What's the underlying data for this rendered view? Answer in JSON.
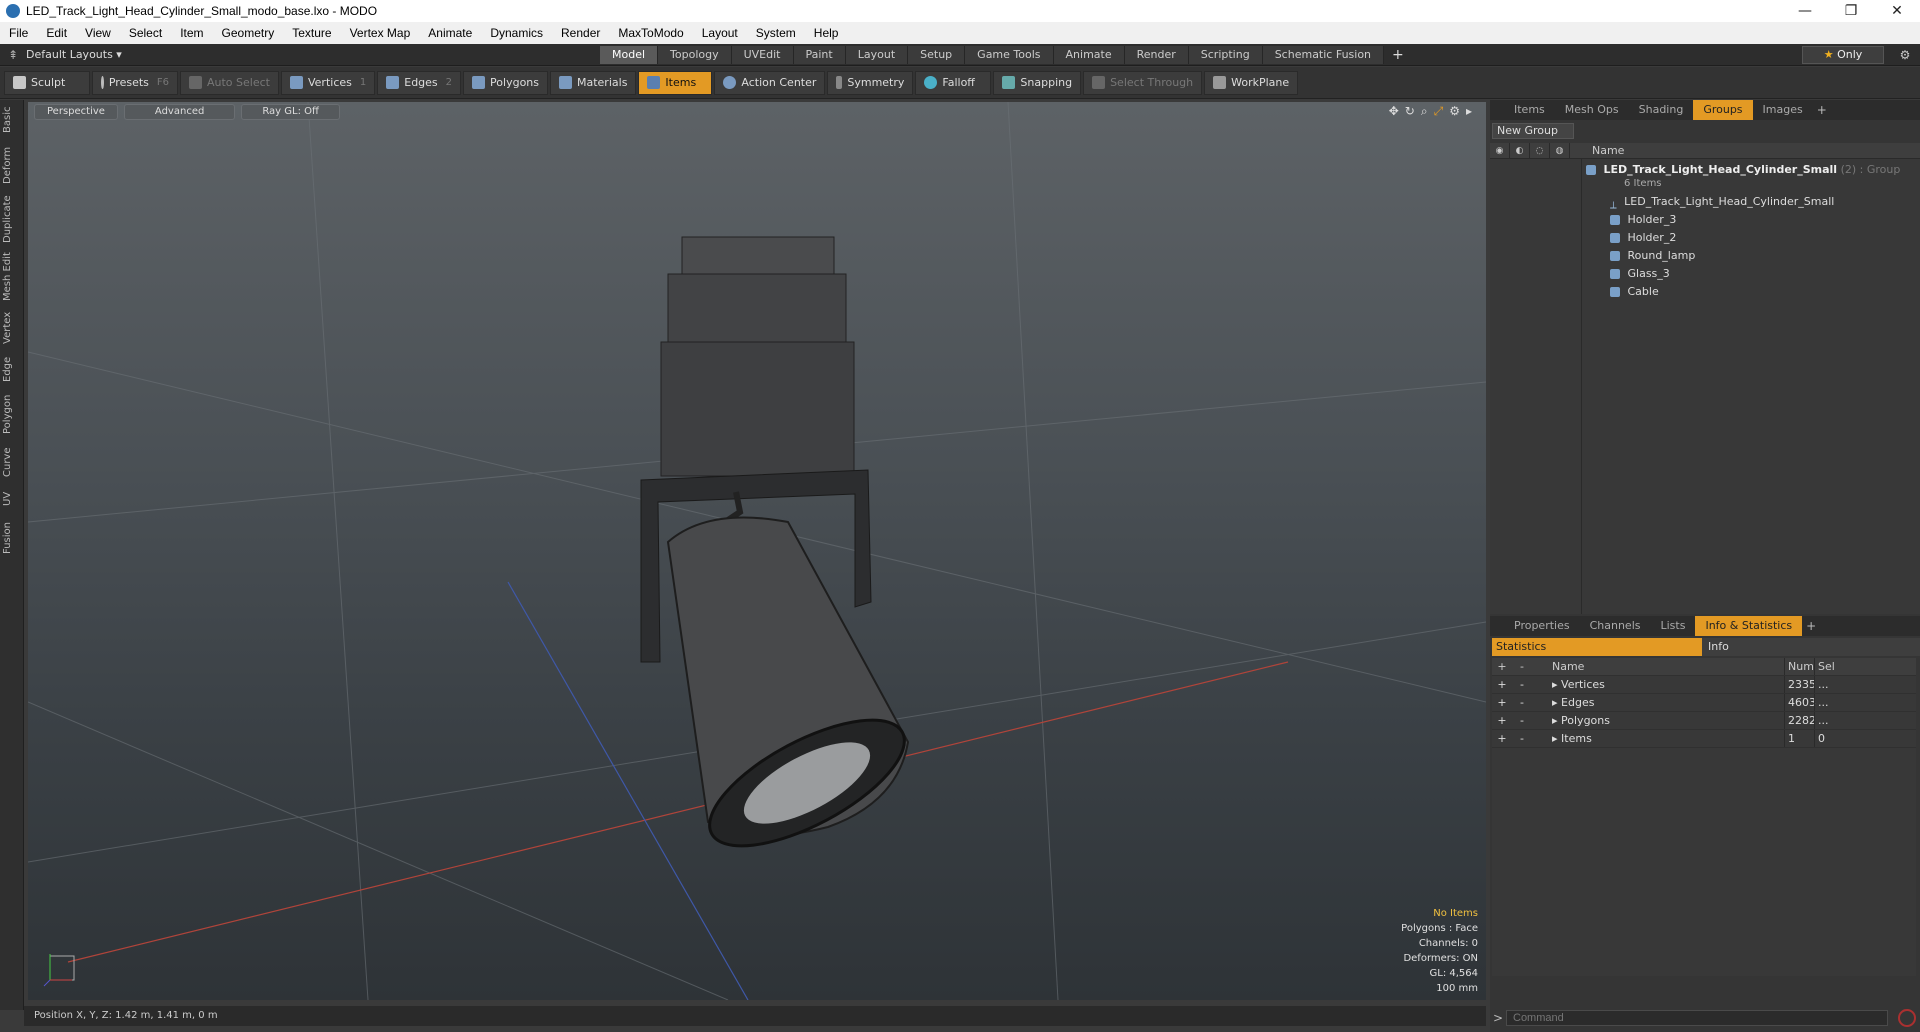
{
  "window": {
    "title": "LED_Track_Light_Head_Cylinder_Small_modo_base.lxo - MODO",
    "controls": [
      "—",
      "❐",
      "✕"
    ]
  },
  "menu": [
    "File",
    "Edit",
    "View",
    "Select",
    "Item",
    "Geometry",
    "Texture",
    "Vertex Map",
    "Animate",
    "Dynamics",
    "Render",
    "MaxToModo",
    "Layout",
    "System",
    "Help"
  ],
  "layout_selector": "Default Layouts ▾",
  "mode_tabs": [
    "Model",
    "Topology",
    "UVEdit",
    "Paint",
    "Layout",
    "Setup",
    "Game Tools",
    "Animate",
    "Render",
    "Scripting",
    "Schematic Fusion"
  ],
  "active_mode_tab": "Model",
  "only_button": "Only",
  "toolbar": {
    "sculpt": "Sculpt",
    "presets": "Presets",
    "presets_key": "F6",
    "auto_select": "Auto Select",
    "vertices": "Vertices",
    "vertices_count": "1",
    "edges": "Edges",
    "edges_count": "2",
    "polygons": "Polygons",
    "materials": "Materials",
    "items": "Items",
    "action_center": "Action Center",
    "symmetry": "Symmetry",
    "falloff": "Falloff",
    "snapping": "Snapping",
    "select_through": "Select Through",
    "workplane": "WorkPlane"
  },
  "left_tabs": [
    "Basic",
    "Deform",
    "Duplicate",
    "Mesh Edit",
    "Vertex",
    "Edge",
    "Polygon",
    "Curve",
    "UV",
    "Fusion"
  ],
  "viewport": {
    "view": "Perspective",
    "shading": "Advanced",
    "raygl": "Ray GL: Off",
    "info": {
      "no_items": "No Items",
      "polygons": "Polygons : Face",
      "channels": "Channels: 0",
      "deformers": "Deformers: ON",
      "gl": "GL: 4,564",
      "scale": "100 mm"
    }
  },
  "status": "Position X, Y, Z:  1.42 m, 1.41 m, 0 m",
  "groups_panel": {
    "tabs": [
      "Items",
      "Mesh Ops",
      "Shading",
      "Groups",
      "Images"
    ],
    "active_tab": "Groups",
    "new_group": "New Group",
    "name_header": "Name",
    "group_name": "LED_Track_Light_Head_Cylinder_Small",
    "group_count": "(2)",
    "group_type": ": Group",
    "group_sub": "6 Items",
    "children": [
      "LED_Track_Light_Head_Cylinder_Small",
      "Holder_3",
      "Holder_2",
      "Round_lamp",
      "Glass_3",
      "Cable"
    ]
  },
  "stats_panel": {
    "tabs": [
      "Properties",
      "Channels",
      "Lists",
      "Info & Statistics"
    ],
    "active_tab": "Info & Statistics",
    "sub_tabs": [
      "Statistics",
      "Info"
    ],
    "headers": {
      "name": "Name",
      "num": "Num",
      "sel": "Sel"
    },
    "rows": [
      {
        "name": "Vertices",
        "num": "2335",
        "sel": "..."
      },
      {
        "name": "Edges",
        "num": "4603",
        "sel": "..."
      },
      {
        "name": "Polygons",
        "num": "2282",
        "sel": "..."
      },
      {
        "name": "Items",
        "num": "1",
        "sel": "0"
      }
    ]
  },
  "command": {
    "placeholder": "Command"
  }
}
